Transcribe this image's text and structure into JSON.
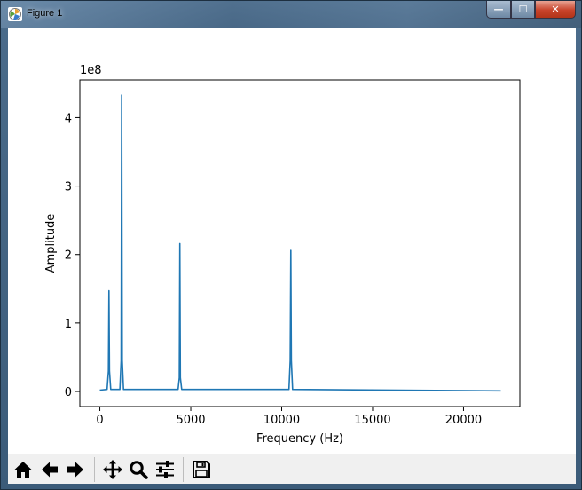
{
  "window": {
    "title": "Figure 1",
    "controls": {
      "minimize": "—",
      "maximize": "☐",
      "close": "✕"
    }
  },
  "toolbar": {
    "buttons": [
      {
        "name": "home",
        "icon": "home-icon"
      },
      {
        "name": "back",
        "icon": "arrow-left-icon"
      },
      {
        "name": "forward",
        "icon": "arrow-right-icon"
      },
      {
        "name": "pan",
        "icon": "move-icon"
      },
      {
        "name": "zoom",
        "icon": "magnifier-icon"
      },
      {
        "name": "configure",
        "icon": "sliders-icon"
      },
      {
        "name": "save",
        "icon": "floppy-disk-icon"
      }
    ]
  },
  "chart_data": {
    "type": "line",
    "title": "",
    "xlabel": "Frequency (Hz)",
    "ylabel": "Amplitude",
    "offset_text": "1e8",
    "xlim": [
      -1100,
      23100
    ],
    "ylim": [
      -0.22,
      4.55
    ],
    "x_ticks": [
      0,
      5000,
      10000,
      15000,
      20000
    ],
    "x_tick_labels": [
      "0",
      "5000",
      "10000",
      "15000",
      "20000"
    ],
    "y_ticks": [
      0,
      1,
      2,
      3,
      4
    ],
    "y_tick_labels": [
      "0",
      "1",
      "2",
      "3",
      "4"
    ],
    "grid": false,
    "color": "#1f77b4",
    "series": [
      {
        "x": [
          0,
          400,
          470,
          500,
          530,
          600,
          1100,
          1170,
          1200,
          1230,
          1300,
          4300,
          4370,
          4400,
          4430,
          4500,
          10400,
          10470,
          10500,
          10530,
          10600,
          22050
        ],
        "values": [
          0.02,
          0.03,
          0.3,
          1.47,
          0.3,
          0.03,
          0.03,
          0.45,
          4.33,
          0.45,
          0.03,
          0.03,
          0.2,
          2.16,
          0.2,
          0.03,
          0.03,
          0.45,
          2.06,
          0.45,
          0.03,
          0.01
        ]
      }
    ]
  }
}
